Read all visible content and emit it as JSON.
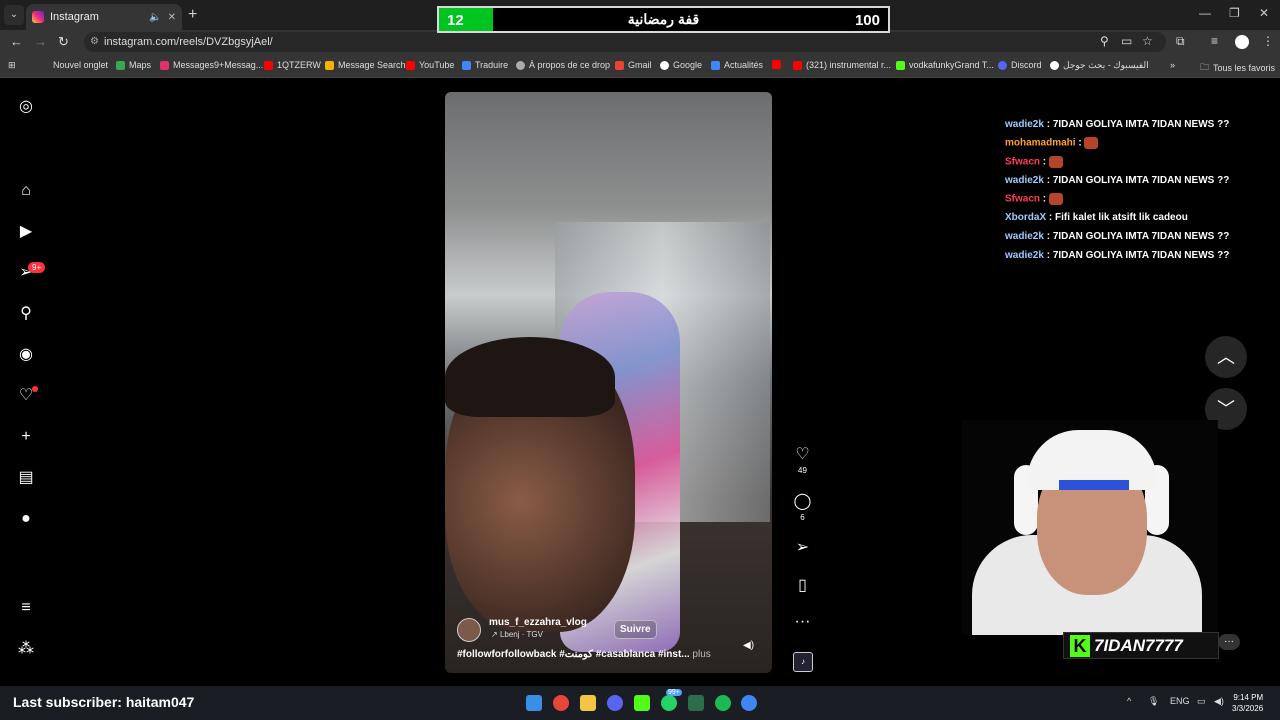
{
  "browser": {
    "tab_title": "Instagram",
    "url": "instagram.com/reels/DVZbgsyjAel/",
    "bookmarks": [
      "Nouvel onglet",
      "Maps",
      "Messages9+Messag...",
      "1QTZERW",
      "Message Search",
      "YouTube",
      "Traduire",
      "À propos de ce drop",
      "Gmail",
      "Google",
      "Actualités",
      "(321) instrumental r...",
      "vodkafunkyGrand T...",
      "Discord",
      "الفيسبوك - بحث جوجل"
    ],
    "all_bookmarks": "Tous les favoris"
  },
  "sidebar": {
    "notifications_badge": "9+",
    "icons": [
      "instagram-logo-icon",
      "home-icon",
      "reels-icon",
      "messages-icon",
      "search-icon",
      "explore-icon",
      "notifications-icon",
      "create-icon",
      "dashboard-icon",
      "profile-icon",
      "more-menu-icon",
      "meta-apps-icon"
    ]
  },
  "reel": {
    "username": "mus_f_ezzahra_vlog",
    "audio": "Lbenj · TGV",
    "follow_label": "Suivre",
    "caption": "#followforfollowback #كومنت #casablanca #inst...",
    "more_label": "plus",
    "likes": "49",
    "comments": "6"
  },
  "goal": {
    "current": "12",
    "title": "قفة رمضانية",
    "target": "100",
    "progress": 0.12,
    "fill_color": "#00c41f"
  },
  "chat": [
    {
      "user": "wadie2k",
      "color": "#9fc9ff",
      "message": "7IDAN GOLIYA IMTA 7IDAN NEWS ??"
    },
    {
      "user": "mohamadmahi",
      "color": "#ff9f2e",
      "message": "",
      "emote": true
    },
    {
      "user": "Sfwacn",
      "color": "#ff3b5c",
      "message": "",
      "emote": true
    },
    {
      "user": "wadie2k",
      "color": "#9fc9ff",
      "message": "7IDAN GOLIYA IMTA 7IDAN NEWS ??"
    },
    {
      "user": "Sfwacn",
      "color": "#ff3b5c",
      "message": "",
      "emote": true
    },
    {
      "user": "XbordaX",
      "color": "#9fc9ff",
      "message": "Fifi kalet lik atsift lik cadeou"
    },
    {
      "user": "wadie2k",
      "color": "#9fc9ff",
      "message": "7IDAN GOLIYA IMTA 7IDAN NEWS ??"
    },
    {
      "user": "wadie2k",
      "color": "#9fc9ff",
      "message": "7IDAN GOLIYA IMTA 7IDAN NEWS ??"
    }
  ],
  "streamer": {
    "name": "7IDAN7777",
    "last_subscriber": "Last subscriber: haitam047"
  },
  "taskbar": {
    "lang": "ENG",
    "time": "9:14 PM",
    "date": "3/3/2026",
    "discord_badge": "99+"
  }
}
